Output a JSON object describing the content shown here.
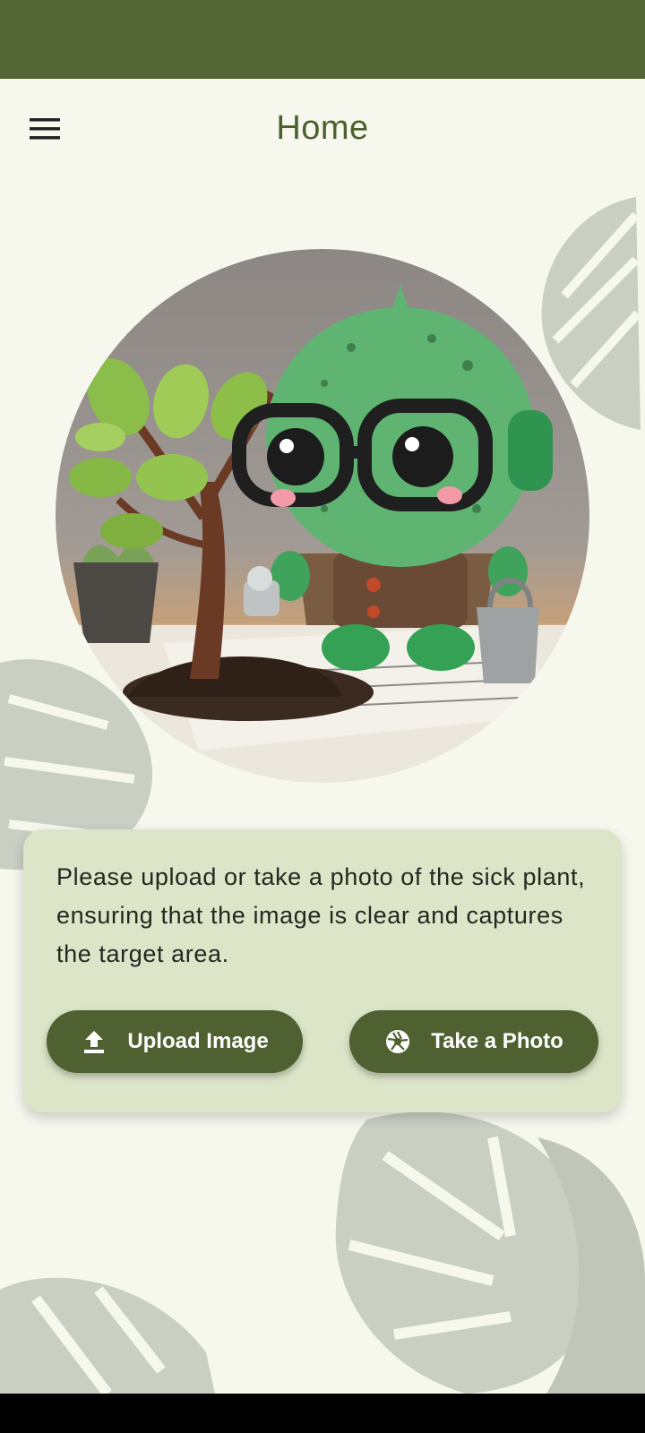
{
  "app_bar": {
    "title": "Home",
    "menu_icon": "hamburger-menu-icon"
  },
  "hero": {
    "image": "plant-doctor-robot-illustration"
  },
  "card": {
    "instructions": "Please upload or take a photo of the sick plant, ensuring that the image is clear and captures the target area."
  },
  "buttons": {
    "upload_label": "Upload Image",
    "upload_icon": "upload-icon",
    "photo_label": "Take a Photo",
    "photo_icon": "camera-shutter-icon"
  },
  "colors": {
    "primary": "#4f6130",
    "status_bar": "#536534",
    "background": "#f6f8ee",
    "card": "#dde5c9",
    "title": "#4c612d"
  }
}
